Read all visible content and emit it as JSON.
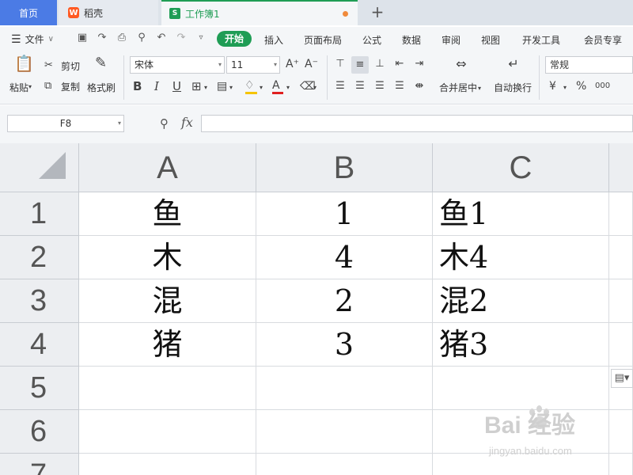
{
  "tabs": {
    "home": "首页",
    "docer": "稻壳",
    "docer_icon_letter": "W",
    "workbook": "工作簿1",
    "workbook_icon_letter": "S",
    "new_tab": "+"
  },
  "menu": {
    "file": "文件",
    "start": "开始",
    "items": [
      "插入",
      "页面布局",
      "公式",
      "数据",
      "审阅",
      "视图",
      "开发工具",
      "会员专享"
    ]
  },
  "ribbon": {
    "paste": "粘贴",
    "cut": "剪切",
    "copy": "复制",
    "format_painter": "格式刷",
    "font_name": "宋体",
    "font_size": "11",
    "grow_font": "A⁺",
    "shrink_font": "A⁻",
    "bold": "B",
    "italic": "I",
    "underline": "U",
    "font_color_letter": "A",
    "merge_center": "合并居中",
    "wrap_text": "自动换行",
    "number_format": "常规",
    "currency": "¥",
    "percent": "%",
    "thousands": "000",
    "colors": {
      "fill": "#f5c400",
      "font": "#e02020"
    }
  },
  "formula_bar": {
    "name_box": "F8",
    "fx": "fx",
    "formula": ""
  },
  "sheet": {
    "columns": [
      "A",
      "B",
      "C"
    ],
    "rows": [
      "1",
      "2",
      "3",
      "4",
      "5",
      "6",
      "7"
    ],
    "cells": [
      [
        "鱼",
        "1",
        "鱼1"
      ],
      [
        "木",
        "4",
        "木4"
      ],
      [
        "混",
        "2",
        "混2"
      ],
      [
        "猪",
        "3",
        "猪3"
      ]
    ]
  },
  "watermark": {
    "brand": "Bai  经验",
    "url": "jingyan.baidu.com"
  }
}
